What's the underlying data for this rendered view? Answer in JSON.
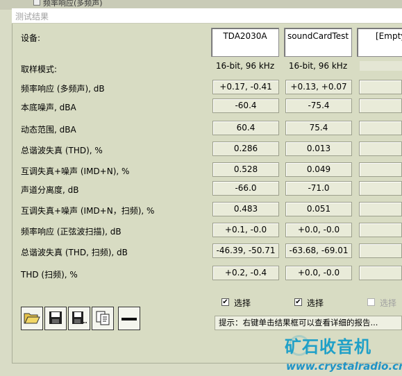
{
  "background_window": {
    "title": "频率响应(多频声)"
  },
  "window": {
    "title": "测试结果"
  },
  "labels": {
    "device": "设备:",
    "sampling_mode": "取样模式:",
    "rows": [
      "频率响应 (多频声), dB",
      "本底噪声, dBA",
      "动态范围, dBA",
      "总谐波失真 (THD), %",
      "互调失真+噪声 (IMD+N), %",
      "声道分离度, dB",
      "互调失真+噪声 (IMD+N，扫频), %",
      "频率响应 (正弦波扫描), dB",
      "总谐波失真 (THD, 扫频), dB",
      "THD (扫频), %"
    ]
  },
  "columns": [
    {
      "device": "TDA2030A",
      "mode": "16-bit, 96 kHz",
      "values": [
        "+0.17, -0.41",
        "-60.4",
        "60.4",
        "0.286",
        "0.528",
        "-66.0",
        "0.483",
        "+0.1, -0.0",
        "-46.39, -50.71",
        "+0.2, -0.4"
      ],
      "select_label": "选择",
      "selected": true
    },
    {
      "device": "soundCardTest",
      "mode": "16-bit, 96 kHz",
      "values": [
        "+0.13, +0.07",
        "-75.4",
        "75.4",
        "0.013",
        "0.049",
        "-71.0",
        "0.051",
        "+0.0, -0.0",
        "-63.68, -69.01",
        "+0.0, -0.0"
      ],
      "select_label": "选择",
      "selected": true
    },
    {
      "device": "[Empty",
      "mode": "",
      "values": [
        "",
        "",
        "",
        "",
        "",
        "",
        "",
        "",
        "",
        ""
      ],
      "select_label": "选择",
      "selected": false
    }
  ],
  "toolbar": {
    "buttons": [
      "open-folder-icon",
      "save-icon",
      "save-as-icon",
      "copy-icon",
      "remove-icon"
    ]
  },
  "hint": "提示：右键单击结果框可以查看详细的报告...",
  "watermark": {
    "text": "矿石收音机",
    "url": "www.crystalradio.cn"
  },
  "colors": {
    "panel": "#d8dcc3",
    "value_box": "#e9ebd9",
    "watermark": "#1fa0c8"
  }
}
